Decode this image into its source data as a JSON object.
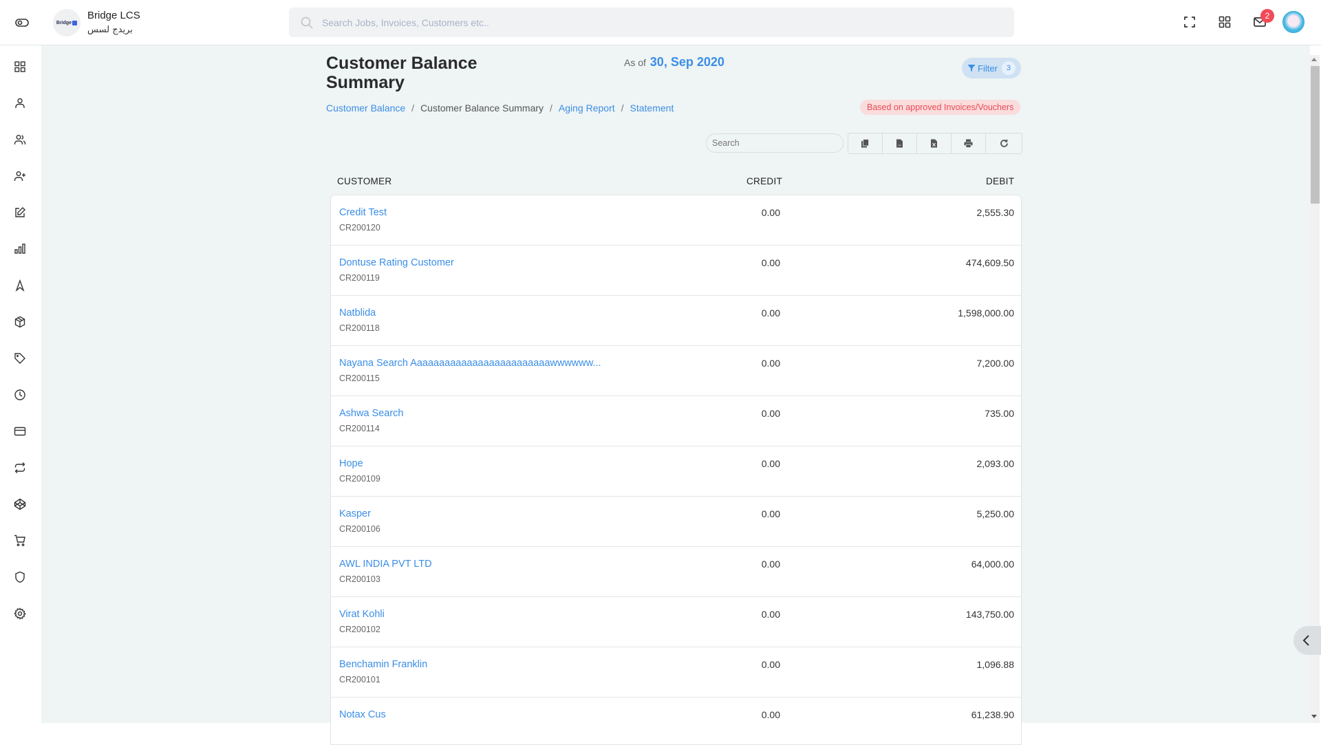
{
  "header": {
    "brand_name": "Bridge LCS",
    "brand_arabic": "بريدج لسس",
    "logo_text": "Bridge",
    "search_placeholder": "Search Jobs, Invoices, Customers etc..",
    "notification_count": "2",
    "icons": [
      "sidebar-toggle-icon",
      "fullscreen-icon",
      "apps-grid-icon",
      "mail-icon",
      "user-avatar"
    ]
  },
  "sidebar": {
    "items": [
      {
        "icon": "dashboard-icon"
      },
      {
        "icon": "user-icon"
      },
      {
        "icon": "users-icon"
      },
      {
        "icon": "user-add-icon"
      },
      {
        "icon": "edit-icon"
      },
      {
        "icon": "bar-chart-icon"
      },
      {
        "icon": "navigation-icon"
      },
      {
        "icon": "package-icon"
      },
      {
        "icon": "tag-icon"
      },
      {
        "icon": "clock-icon"
      },
      {
        "icon": "credit-card-icon"
      },
      {
        "icon": "repeat-icon"
      },
      {
        "icon": "codepen-icon"
      },
      {
        "icon": "cart-icon"
      },
      {
        "icon": "shield-icon"
      },
      {
        "icon": "settings-icon"
      }
    ]
  },
  "page": {
    "title": "Customer Balance Summary",
    "as_of_label": "As of",
    "as_of_date": "30, Sep 2020",
    "filter_label": "Filter",
    "filter_count": "3",
    "breadcrumb": {
      "customer_balance": "Customer Balance",
      "current": "Customer Balance Summary",
      "aging_report": "Aging Report",
      "statement": "Statement",
      "separator": "/"
    },
    "note": "Based on approved Invoices/Vouchers",
    "table_search_placeholder": "Search",
    "tools": [
      "copy-icon",
      "csv-icon",
      "excel-icon",
      "print-icon",
      "refresh-icon"
    ]
  },
  "table": {
    "columns": [
      "CUSTOMER",
      "CREDIT",
      "DEBIT"
    ],
    "rows": [
      {
        "name": "Credit Test",
        "code": "CR200120",
        "credit": "0.00",
        "debit": "2,555.30"
      },
      {
        "name": "Dontuse Rating Customer",
        "code": "CR200119",
        "credit": "0.00",
        "debit": "474,609.50"
      },
      {
        "name": "Natblida",
        "code": "CR200118",
        "credit": "0.00",
        "debit": "1,598,000.00"
      },
      {
        "name": "Nayana Search Aaaaaaaaaaaaaaaaaaaaaaaaawwwwww...",
        "code": "CR200115",
        "credit": "0.00",
        "debit": "7,200.00"
      },
      {
        "name": "Ashwa Search",
        "code": "CR200114",
        "credit": "0.00",
        "debit": "735.00"
      },
      {
        "name": "Hope",
        "code": "CR200109",
        "credit": "0.00",
        "debit": "2,093.00"
      },
      {
        "name": "Kasper",
        "code": "CR200106",
        "credit": "0.00",
        "debit": "5,250.00"
      },
      {
        "name": "AWL INDIA PVT LTD",
        "code": "CR200103",
        "credit": "0.00",
        "debit": "64,000.00"
      },
      {
        "name": "Virat Kohli",
        "code": "CR200102",
        "credit": "0.00",
        "debit": "143,750.00"
      },
      {
        "name": "Benchamin Franklin",
        "code": "CR200101",
        "credit": "0.00",
        "debit": "1,096.88"
      },
      {
        "name": "Notax Cus",
        "code": "",
        "credit": "0.00",
        "debit": "61,238.90"
      }
    ]
  },
  "colors": {
    "accent": "#3a8ee6",
    "background": "#eff4f4",
    "badge": "#f24b57",
    "note_text": "#e94b55",
    "note_bg": "#fadcdc"
  }
}
